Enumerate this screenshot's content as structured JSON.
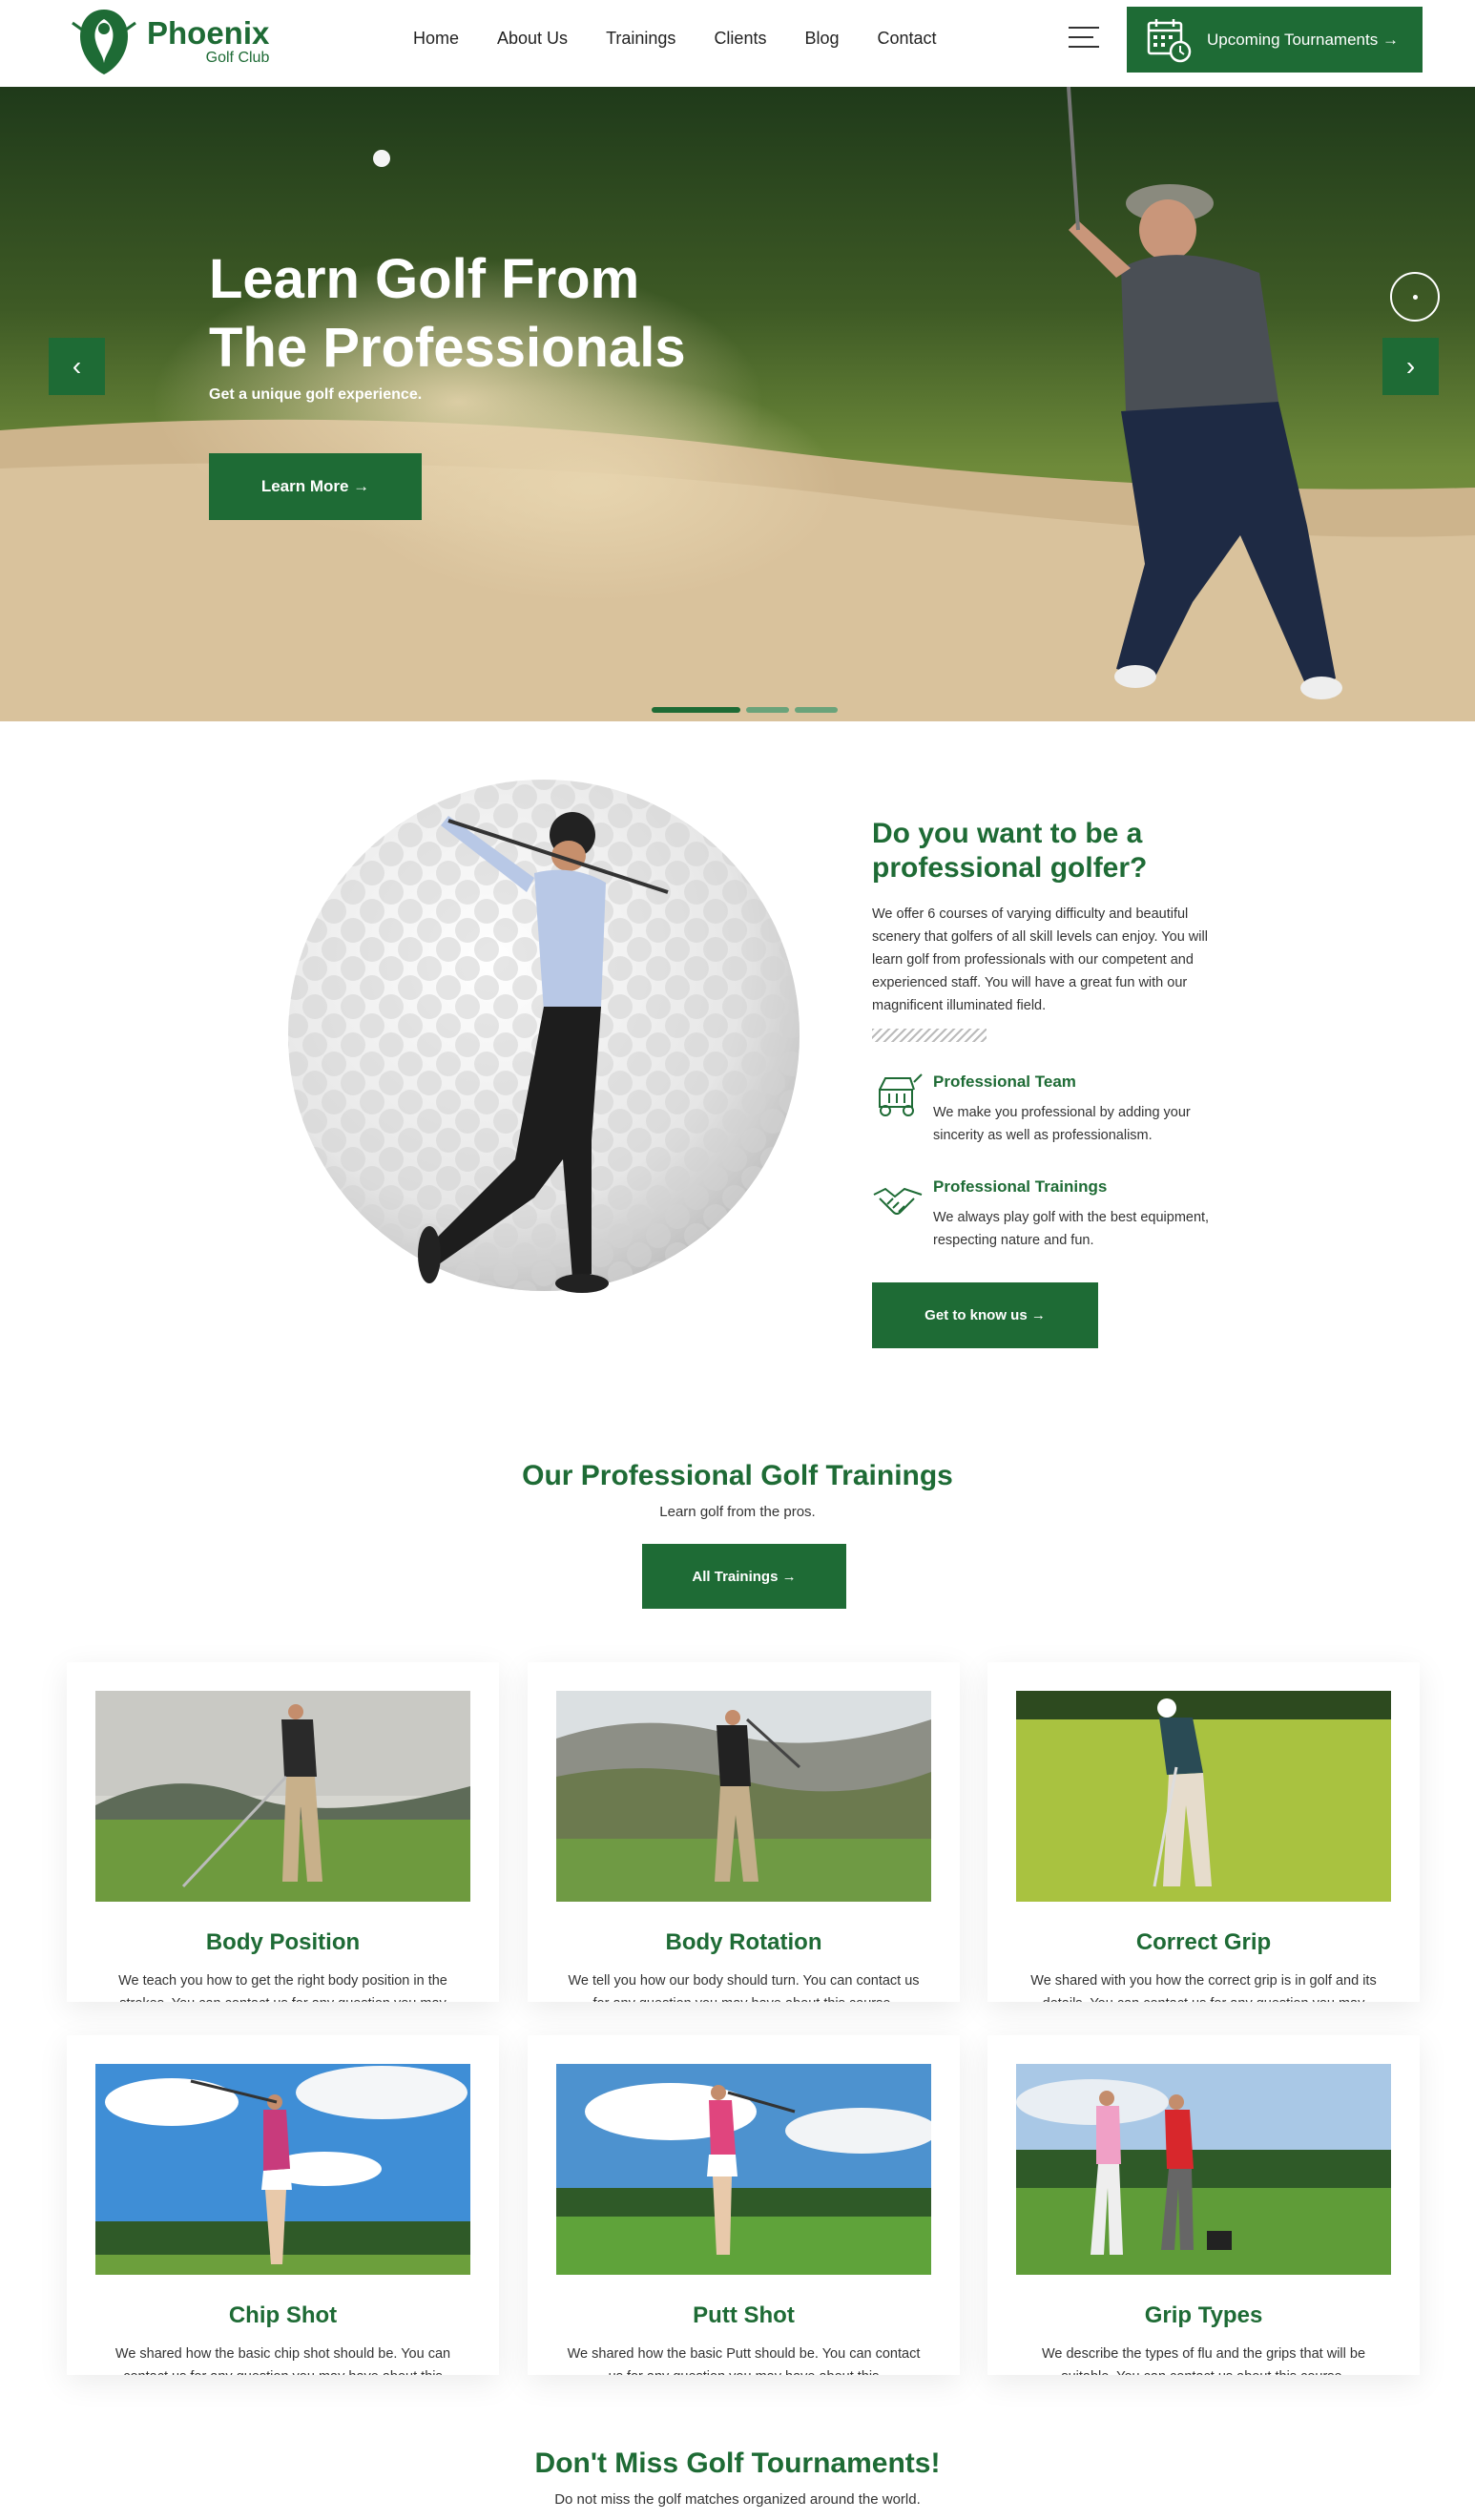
{
  "brand": {
    "name": "Phoenix",
    "sub": "Golf Club",
    "green": "#1e6b35"
  },
  "nav": {
    "items": [
      "Home",
      "About Us",
      "Trainings",
      "Clients",
      "Blog",
      "Contact"
    ],
    "menu_icon": "hamburger-icon",
    "cta": "Upcoming Tournaments →",
    "cta_icon": "calendar-clock-icon"
  },
  "hero": {
    "title_line1": "Learn Golf From",
    "title_line2": "The Professionals",
    "subtitle": "Get a unique golf experience.",
    "button": "Learn More →",
    "prev": "‹",
    "next": "›",
    "slides_total": 3,
    "slide_active": 1
  },
  "about": {
    "title": "Do you want to be a professional golfer?",
    "description": "We offer 6 courses of varying difficulty and beautiful scenery that golfers of all skill levels can enjoy. You will learn golf from professionals with our competent and experienced staff. You will have a great fun with our magnificent illuminated field.",
    "features": [
      {
        "title": "Professional Team",
        "text": "We make you professional by adding your sincerity as well as professionalism.",
        "icon": "golf-cart-icon"
      },
      {
        "title": "Professional Trainings",
        "text": "We always play golf with the best equipment, respecting nature and fun.",
        "icon": "handshake-icon"
      }
    ],
    "button": "Get to know us →"
  },
  "trainings": {
    "title": "Our Professional Golf Trainings",
    "subtitle": "Learn golf from the pros.",
    "button": "All Trainings →",
    "cards": [
      {
        "title": "Body Position",
        "text": "We teach you how to get the right body position in the strokes. You can contact us for any question you may"
      },
      {
        "title": "Body Rotation",
        "text": "We tell you how our body should turn. You can contact us for any question you may have about this course."
      },
      {
        "title": "Correct Grip",
        "text": "We shared with you how the correct grip is in golf and its details. You can contact us for any question you may"
      },
      {
        "title": "Chip Shot",
        "text": "We shared how the basic chip shot should be. You can contact us for any question you may have about this"
      },
      {
        "title": "Putt Shot",
        "text": "We shared how the basic Putt should be. You can contact us for any question you may have about this"
      },
      {
        "title": "Grip Types",
        "text": "We describe the types of flu and the grips that will be suitable. You can contact us about this course."
      }
    ]
  },
  "tournaments": {
    "title": "Don't Miss Golf Tournaments!",
    "subtitle": "Do not miss the golf matches organized around the world."
  }
}
